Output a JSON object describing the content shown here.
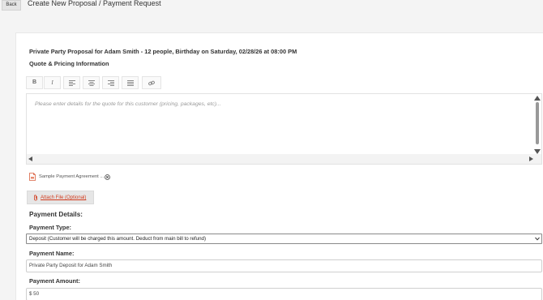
{
  "header": {
    "back_label": "Back",
    "title": "Create New Proposal / Payment Request"
  },
  "proposal": {
    "summary": "Private Party Proposal for Adam Smith - 12 people, Birthday on Saturday, 02/28/26 at 08:00 PM",
    "section_label": "Quote & Pricing Information"
  },
  "toolbar": {
    "bold": "B",
    "italic": "I",
    "buttons": [
      "bold",
      "italic",
      "align-left-icon",
      "align-center-icon",
      "align-right-icon",
      "justify-icon",
      "link-icon"
    ]
  },
  "editor": {
    "placeholder": "Please enter details for the quote for this customer (pricing, packages, etc)..."
  },
  "attachment": {
    "file_name": "Sample Payment Agreement ...",
    "icon": "pdf-file-icon",
    "remove_icon": "remove-circle-icon"
  },
  "attach_button": {
    "label": "Attach File (Optional)",
    "icon": "paperclip-icon"
  },
  "payment": {
    "section_title": "Payment Details:",
    "type_label": "Payment Type:",
    "type_value": "Deposit (Customer will be charged this amount. Deduct from main bill to refund)",
    "name_label": "Payment Name:",
    "name_value": "Private Party Deposit for Adam Smith",
    "amount_label": "Payment Amount:",
    "amount_value": "$ 50"
  },
  "colors": {
    "accent": "#d13a1c",
    "background": "#f4f4f4",
    "panel": "#ffffff"
  }
}
